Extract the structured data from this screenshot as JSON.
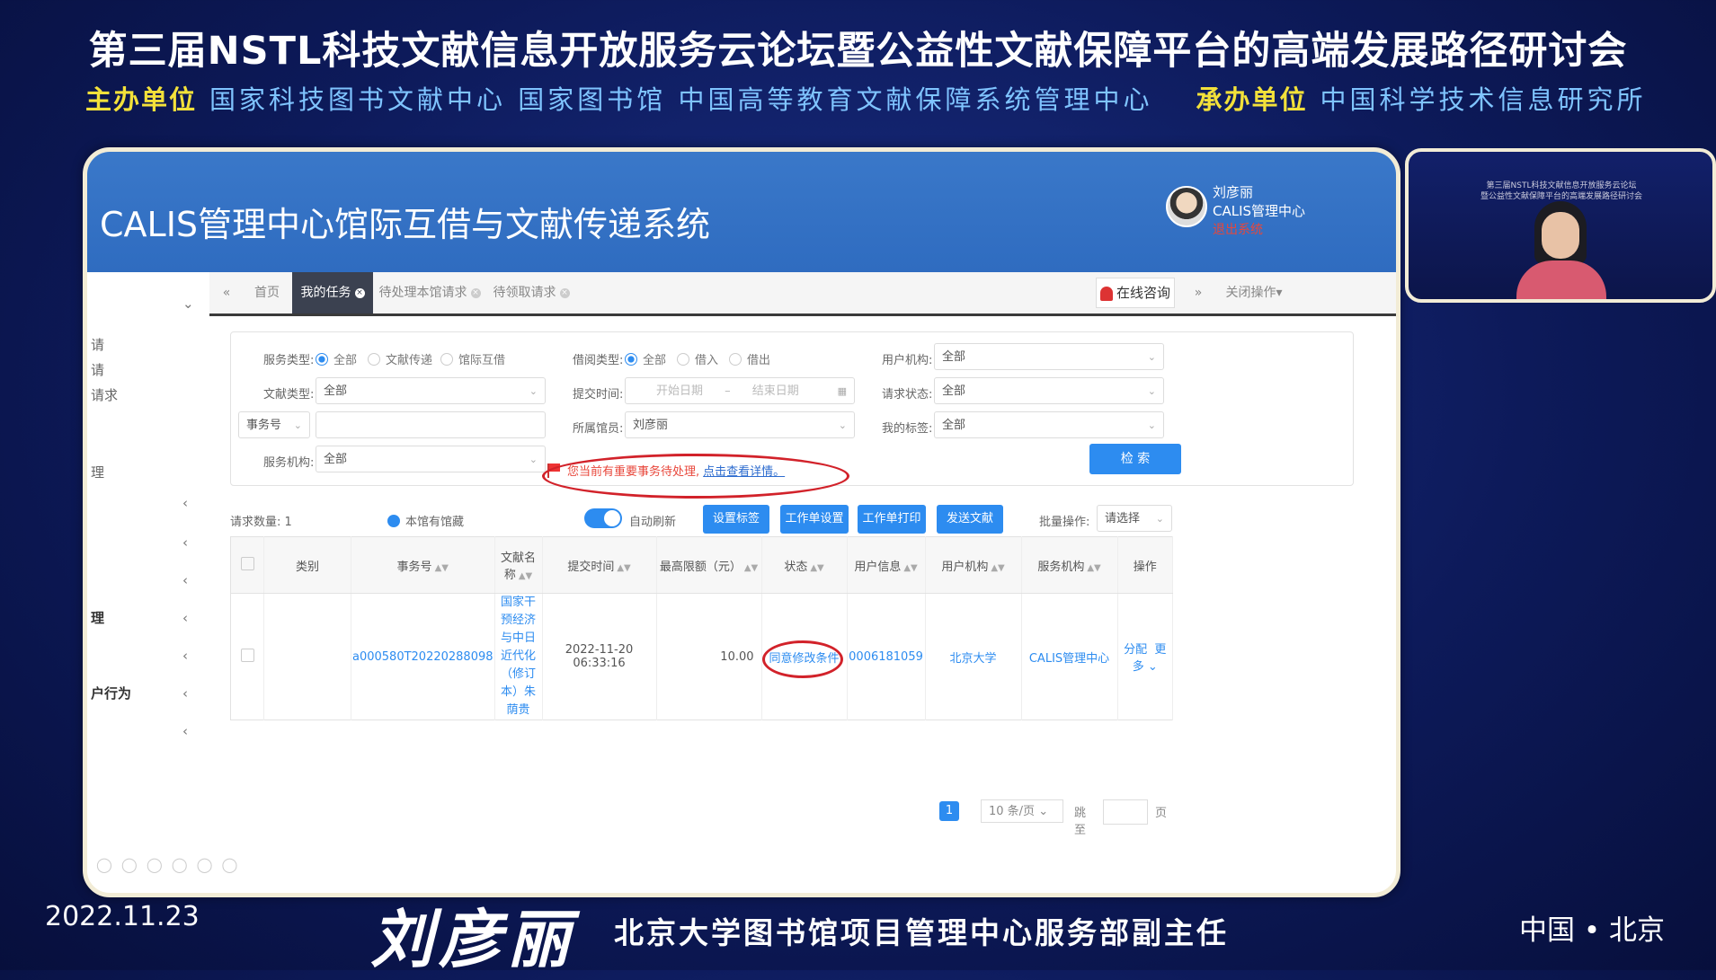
{
  "banner": {
    "title": "第三届NSTL科技文献信息开放服务云论坛暨公益性文献保障平台的高端发展路径研讨会",
    "host_label": "主办单位",
    "hosts": "国家科技图书文献中心 国家图书馆 中国高等教育文献保障系统管理中心",
    "organizer_label": "承办单位",
    "organizer": "中国科学技术信息研究所"
  },
  "app": {
    "title": "CALIS管理中心馆际互借与文献传递系统",
    "user_name": "刘彦丽",
    "user_org": "CALIS管理中心",
    "logout": "退出系统"
  },
  "tabs": {
    "home": "首页",
    "my_tasks": "我的任务",
    "pending_local": "待处理本馆请求",
    "pending_claim": "待领取请求",
    "consult": "在线咨询",
    "close_ops": "关闭操作"
  },
  "sidebar": {
    "items": [
      "请",
      "请",
      "请求",
      "理",
      "理",
      "户行为"
    ]
  },
  "filters": {
    "service_type_label": "服务类型:",
    "service_type_options": [
      "全部",
      "文献传递",
      "馆际互借"
    ],
    "borrow_type_label": "借阅类型:",
    "borrow_type_options": [
      "全部",
      "借入",
      "借出"
    ],
    "user_org_label": "用户机构:",
    "user_org_value": "全部",
    "doc_type_label": "文献类型:",
    "doc_type_value": "全部",
    "submit_time_label": "提交时间:",
    "start_placeholder": "开始日期",
    "date_sep": "–",
    "end_placeholder": "结束日期",
    "request_status_label": "请求状态:",
    "request_status_value": "全部",
    "tx_no_select": "事务号",
    "librarian_label": "所属馆员:",
    "librarian_value": "刘彦丽",
    "my_tags_label": "我的标签:",
    "my_tags_value": "全部",
    "service_org_label": "服务机构:",
    "service_org_value": "全部",
    "search_btn": "检 索",
    "alert_text": "您当前有重要事务待处理,",
    "alert_link": "点击查看详情。"
  },
  "toolbar": {
    "request_count": "请求数量: 1",
    "local_holding": "本馆有馆藏",
    "auto_refresh": "自动刷新",
    "set_tag": "设置标签",
    "ticket_settings": "工作单设置",
    "ticket_print": "工作单打印",
    "send_doc": "发送文献",
    "batch_label": "批量操作:",
    "batch_select": "请选择"
  },
  "table": {
    "headers": [
      "类别",
      "事务号",
      "文献名称",
      "提交时间",
      "最高限额（元）",
      "状态",
      "用户信息",
      "用户机构",
      "服务机构",
      "操作"
    ],
    "row": {
      "category": "",
      "tx_no": "a000580T20220288098",
      "doc_title": "国家干预经济与中日近代化（修订本）朱荫贵",
      "submit_time": "2022-11-20 06:33:16",
      "max_amount": "10.00",
      "status": "同意修改条件",
      "user_info": "0006181059",
      "user_org": "北京大学",
      "service_org": "CALIS管理中心",
      "op_assign": "分配",
      "op_more": "更多"
    }
  },
  "pager": {
    "current": "1",
    "page_size": "10 条/页",
    "jump": "跳至",
    "page": "页"
  },
  "footer": {
    "date": "2022.11.23",
    "speaker": "刘彦丽",
    "role": "北京大学图书馆项目管理中心服务部副主任",
    "location": "中国 • 北京"
  },
  "video": {
    "caption_line1": "第三届NSTL科技文献信息开放服务云论坛",
    "caption_line2": "暨公益性文献保障平台的高端发展路径研讨会"
  },
  "colors": {
    "accent": "#2d8cf0",
    "header": "#3a78c9",
    "alert": "#e8473b",
    "highlight": "#d2222a"
  }
}
